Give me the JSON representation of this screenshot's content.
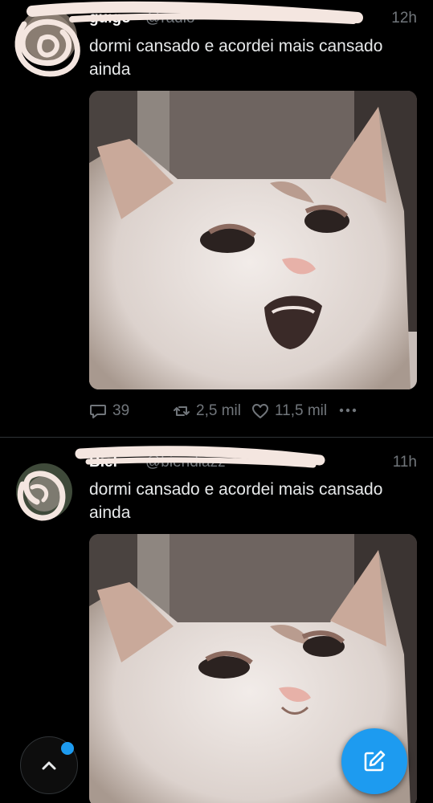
{
  "tweets": [
    {
      "display_name": "guigo",
      "handle": "@radio",
      "time": "12h",
      "text": "dormi cansado e acordei mais cansado ainda",
      "media_description": "sad-white-cat-yawning",
      "stats": {
        "replies": "39",
        "retweets": "2,5 mil",
        "likes": "11,5 mil"
      }
    },
    {
      "display_name": "Biel",
      "handle": "@biendiazz",
      "time": "11h",
      "text": "dormi cansado e acordei mais cansado ainda",
      "media_description": "sad-white-cat"
    }
  ],
  "fab": {
    "scroll_top_icon": "chevron-up-icon",
    "compose_icon": "compose-icon",
    "accent": "#1d9bf0"
  }
}
